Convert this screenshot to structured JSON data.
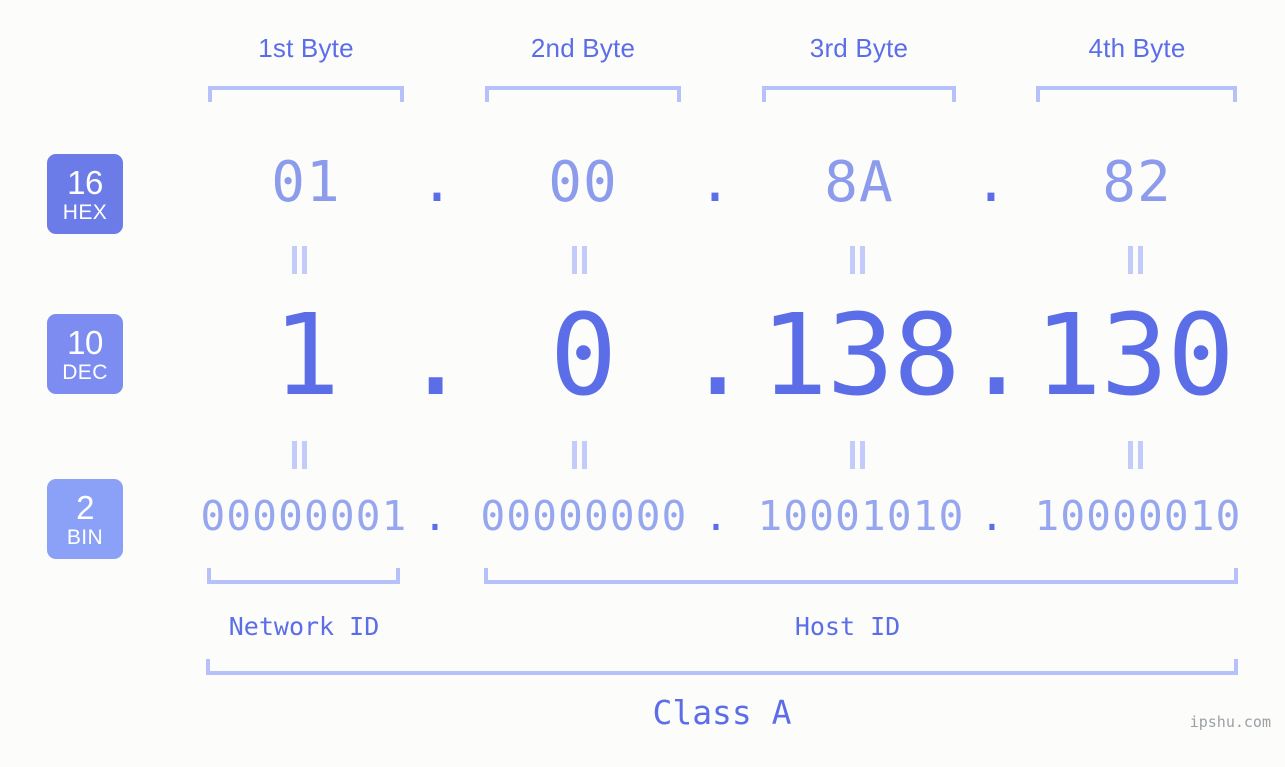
{
  "page": {
    "background_color": "#fcfdfa",
    "watermark": "ipshu.com"
  },
  "colors": {
    "accent_strong": "#5b6ee8",
    "accent_light": "#8c9bec",
    "bracket": "#b6c0fb",
    "equals_mark": "#c2cbfa",
    "badge_hex": "#6b7ce8",
    "badge_dec": "#7d8cf1",
    "badge_bin": "#8ba1f7",
    "watermark": "#9aa0a6"
  },
  "byte_headers": [
    {
      "label": "1st Byte"
    },
    {
      "label": "2nd Byte"
    },
    {
      "label": "3rd Byte"
    },
    {
      "label": "4th Byte"
    }
  ],
  "bases": [
    {
      "number": "16",
      "name": "HEX"
    },
    {
      "number": "10",
      "name": "DEC"
    },
    {
      "number": "2",
      "name": "BIN"
    }
  ],
  "separator": ".",
  "rows": {
    "hex": {
      "base": "16",
      "base_name": "HEX",
      "octets": [
        "01",
        "00",
        "8A",
        "82"
      ]
    },
    "dec": {
      "base": "10",
      "base_name": "DEC",
      "octets": [
        "1",
        "0",
        "138",
        "130"
      ]
    },
    "bin": {
      "base": "2",
      "base_name": "BIN",
      "octets": [
        "00000001",
        "00000000",
        "10001010",
        "10000010"
      ]
    }
  },
  "segments": {
    "network_id": "Network ID",
    "host_id": "Host ID"
  },
  "class": {
    "label": "Class A"
  },
  "ip_address": {
    "hex": "01.00.8A.82",
    "dec": "1.0.138.130",
    "bin": "00000001.00000000.10001010.10000010"
  }
}
